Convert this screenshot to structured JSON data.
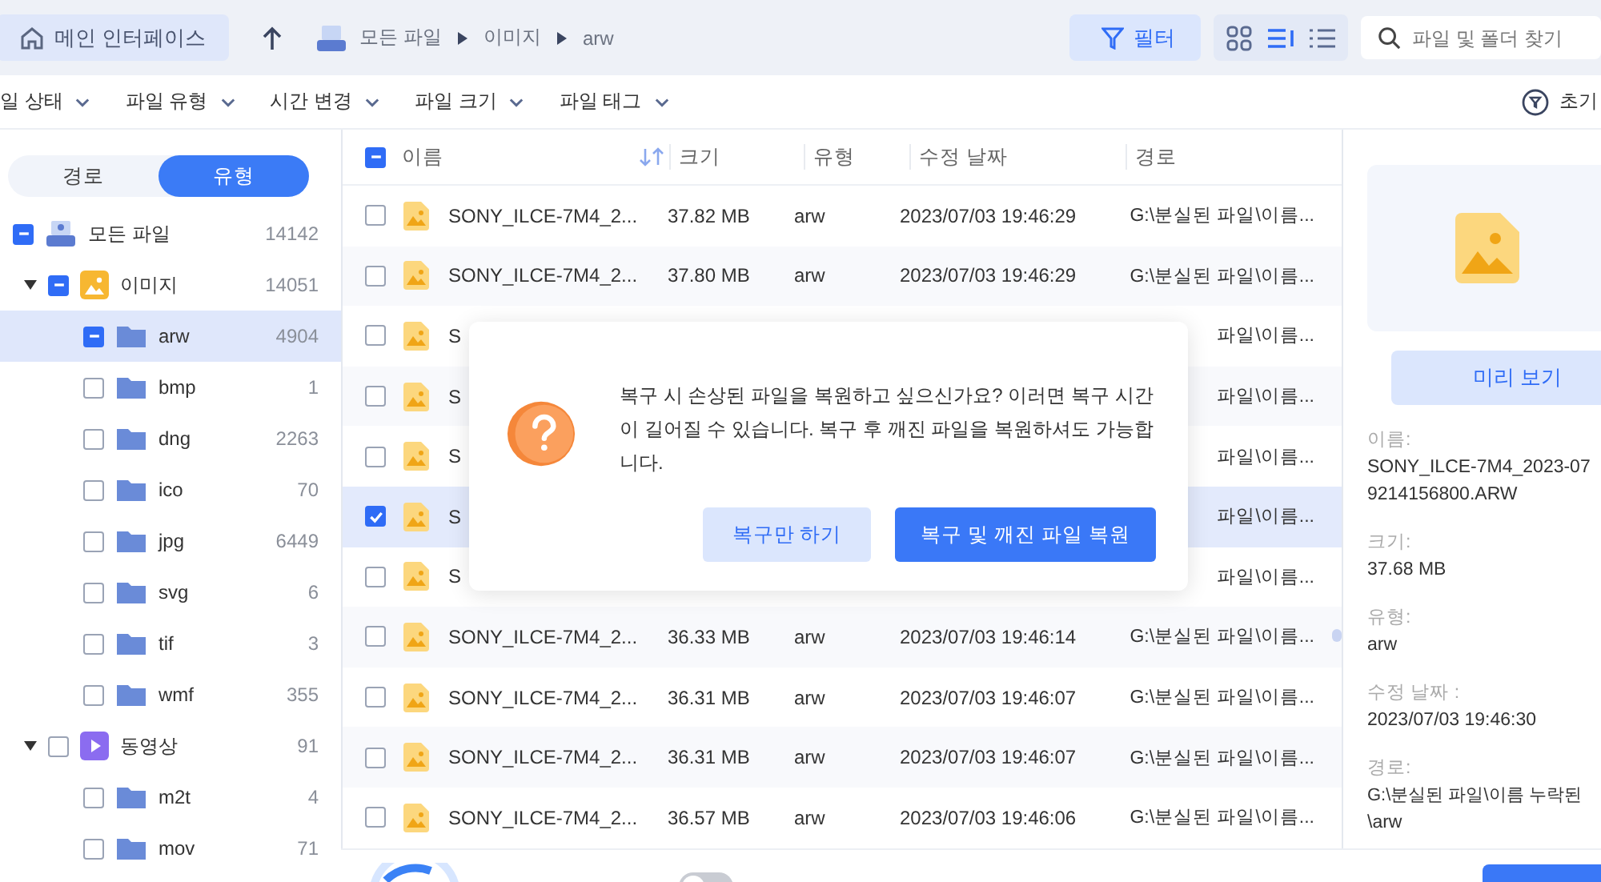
{
  "toolbar": {
    "home": "메인 인터페이스",
    "breadcrumb": [
      "모든 파일",
      "이미지",
      "arw"
    ],
    "filter": {
      "label": "필터",
      "selected": true
    },
    "views": [
      {
        "kind": "grid",
        "selected": false
      },
      {
        "kind": "list",
        "selected": true
      },
      {
        "kind": "details",
        "selected": false
      }
    ],
    "search": {
      "placeholder": "파일 및 폴더 찾기"
    }
  },
  "filters": [
    "일 상태",
    "파일 유형",
    "시간 변경",
    "파일 크기",
    "파일 태그"
  ],
  "reset": "초기",
  "sidebar": {
    "tabs": [
      {
        "label": "경로",
        "selected": false
      },
      {
        "label": "유형",
        "selected": true
      }
    ],
    "tree": [
      {
        "label": "모든 파일",
        "count": "14142",
        "kind": "drive",
        "checked": true,
        "partial": true,
        "selected": false,
        "children": [
          {
            "label": "이미지",
            "count": "14051",
            "kind": "image",
            "checked": true,
            "partial": true,
            "selected": false,
            "expanded": true,
            "children": [
              {
                "label": "arw",
                "count": "4904",
                "kind": "folder",
                "checked": true,
                "partial": true,
                "selected": true
              },
              {
                "label": "bmp",
                "count": "1",
                "kind": "folder",
                "checked": false,
                "selected": false
              },
              {
                "label": "dng",
                "count": "2263",
                "kind": "folder",
                "checked": false,
                "selected": false
              },
              {
                "label": "ico",
                "count": "70",
                "kind": "folder",
                "checked": false,
                "selected": false
              },
              {
                "label": "jpg",
                "count": "6449",
                "kind": "folder",
                "checked": false,
                "selected": false
              },
              {
                "label": "svg",
                "count": "6",
                "kind": "folder",
                "checked": false,
                "selected": false
              },
              {
                "label": "tif",
                "count": "3",
                "kind": "folder",
                "checked": false,
                "selected": false
              },
              {
                "label": "wmf",
                "count": "355",
                "kind": "folder",
                "checked": false,
                "selected": false
              }
            ]
          },
          {
            "label": "동영상",
            "count": "91",
            "kind": "video",
            "checked": false,
            "selected": false,
            "expanded": true,
            "children": [
              {
                "label": "m2t",
                "count": "4",
                "kind": "folder",
                "checked": false,
                "selected": false
              },
              {
                "label": "mov",
                "count": "71",
                "kind": "folder",
                "checked": false,
                "selected": false
              }
            ]
          }
        ]
      }
    ]
  },
  "table": {
    "header_checked": true,
    "header_partial": true,
    "columns": [
      "이름",
      "크기",
      "유형",
      "수정 날짜",
      "경로"
    ],
    "rows": [
      {
        "name": "SONY_ILCE-7M4_2...",
        "size": "37.82 MB",
        "type": "arw",
        "date": "2023/07/03 19:46:29",
        "path": "G:\\분실된 파일\\이름...",
        "checked": false
      },
      {
        "name": "SONY_ILCE-7M4_2...",
        "size": "37.80 MB",
        "type": "arw",
        "date": "2023/07/03 19:46:29",
        "path": "G:\\분실된 파일\\이름...",
        "checked": false
      },
      {
        "name": "S",
        "path": "파일\\이름...",
        "checked": false
      },
      {
        "name": "S",
        "path": "파일\\이름...",
        "checked": false
      },
      {
        "name": "S",
        "path": "파일\\이름...",
        "checked": false
      },
      {
        "name": "S",
        "path": "파일\\이름...",
        "checked": true
      },
      {
        "name": "S",
        "path": "파일\\이름...",
        "checked": false
      },
      {
        "name": "SONY_ILCE-7M4_2...",
        "size": "36.33 MB",
        "type": "arw",
        "date": "2023/07/03 19:46:14",
        "path": "G:\\분실된 파일\\이름...",
        "checked": false
      },
      {
        "name": "SONY_ILCE-7M4_2...",
        "size": "36.31 MB",
        "type": "arw",
        "date": "2023/07/03 19:46:07",
        "path": "G:\\분실된 파일\\이름...",
        "checked": false
      },
      {
        "name": "SONY_ILCE-7M4_2...",
        "size": "36.31 MB",
        "type": "arw",
        "date": "2023/07/03 19:46:07",
        "path": "G:\\분실된 파일\\이름...",
        "checked": false
      },
      {
        "name": "SONY_ILCE-7M4_2...",
        "size": "36.57 MB",
        "type": "arw",
        "date": "2023/07/03 19:46:06",
        "path": "G:\\분실된 파일\\이름...",
        "checked": false
      }
    ]
  },
  "details": {
    "preview_button": "미리 보기",
    "fields": [
      {
        "label": "이름:",
        "lines": [
          "SONY_ILCE-7M4_2023-07",
          "9214156800.ARW"
        ]
      },
      {
        "label": "크기:",
        "lines": [
          "37.68 MB"
        ]
      },
      {
        "label": "유형:",
        "lines": [
          "arw"
        ]
      },
      {
        "label": "수정 날짜 :",
        "lines": [
          "2023/07/03 19:46:30"
        ]
      },
      {
        "label": "경로:",
        "lines": [
          "G:\\분실된 파일\\이름 누락된",
          "\\arw"
        ]
      }
    ]
  },
  "dialog": {
    "message": "복구 시 손상된 파일을 복원하고 싶으신가요? 이러면 복구 시간이 길어질 수 있습니다. 복구 후 깨진 파일을 복원하셔도 가능합니다.",
    "buttons": [
      {
        "label": "복구만 하기",
        "kind": "secondary"
      },
      {
        "label": "복구 및 깨진 파일 복원",
        "kind": "primary"
      }
    ]
  },
  "bottom": {
    "toggle": {
      "on": false
    }
  }
}
